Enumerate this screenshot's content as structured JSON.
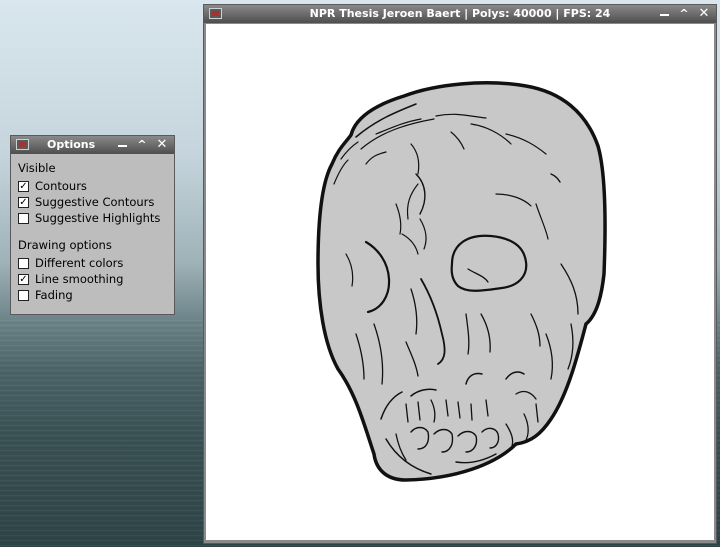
{
  "main_window": {
    "title": "NPR Thesis Jeroen Baert | Polys: 40000 | FPS: 24",
    "icon": "app-icon",
    "buttons": [
      "minimize-icon",
      "maximize-icon",
      "close-icon"
    ]
  },
  "options_window": {
    "title": "Options",
    "icon": "app-icon",
    "buttons": [
      "minimize-icon",
      "maximize-icon",
      "close-icon"
    ],
    "groups": [
      {
        "title": "Visible",
        "options": [
          {
            "label": "Contours",
            "checked": true
          },
          {
            "label": "Suggestive Contours",
            "checked": true
          },
          {
            "label": "Suggestive Highlights",
            "checked": false
          }
        ]
      },
      {
        "title": "Drawing options",
        "options": [
          {
            "label": "Different colors",
            "checked": false
          },
          {
            "label": "Line smoothing",
            "checked": true
          },
          {
            "label": "Fading",
            "checked": false
          }
        ]
      }
    ]
  },
  "colors": {
    "skull_fill": "#c8c8c8",
    "stroke": "#111111",
    "titlebar": "#4e4e4e",
    "window_bg": "#bdbdbd"
  }
}
